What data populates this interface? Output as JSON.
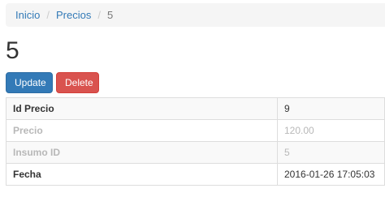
{
  "breadcrumb": {
    "home": "Inicio",
    "section": "Precios",
    "current": "5",
    "separator": "/"
  },
  "page_title": "5",
  "actions": {
    "update_label": "Update",
    "delete_label": "Delete"
  },
  "detail": {
    "rows": [
      {
        "label": "Id Precio",
        "value": "9"
      },
      {
        "label": "Precio",
        "value": "120.00"
      },
      {
        "label": "Insumo ID",
        "value": "5"
      },
      {
        "label": "Fecha",
        "value": "2016-01-26 17:05:03"
      }
    ]
  },
  "colors": {
    "link": "#337ab7",
    "primary": "#337ab7",
    "danger": "#d9534f",
    "breadcrumb_bg": "#f5f5f5"
  }
}
